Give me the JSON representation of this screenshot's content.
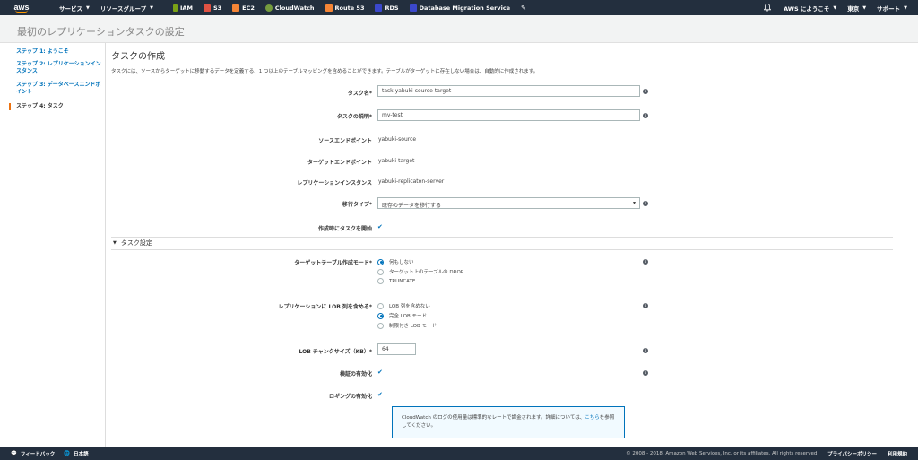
{
  "topnav": {
    "logo": "aws",
    "services": "サービス",
    "resource_groups": "リソースグループ",
    "shortcuts": [
      {
        "label": "IAM",
        "color": "#7aa116"
      },
      {
        "label": "S3",
        "color": "#e05243"
      },
      {
        "label": "EC2",
        "color": "#f58536"
      },
      {
        "label": "CloudWatch",
        "color": "#759c3e"
      },
      {
        "label": "Route 53",
        "color": "#f58536"
      },
      {
        "label": "RDS",
        "color": "#3b48cc"
      },
      {
        "label": "Database Migration Service",
        "color": "#3b48cc"
      }
    ],
    "pin_icon": "pin-icon",
    "bell_icon": "bell-icon",
    "account": "AWS にようこそ",
    "region": "東京",
    "support": "サポート"
  },
  "page_title": "最初のレプリケーションタスクの設定",
  "sidebar": {
    "steps": [
      {
        "label": "ステップ 1: ようこそ"
      },
      {
        "label": "ステップ 2: レプリケーションインスタンス"
      },
      {
        "label": "ステップ 3: データベースエンドポイント"
      },
      {
        "label": "ステップ 4: タスク"
      }
    ]
  },
  "main": {
    "title": "タスクの作成",
    "description": "タスクには、ソースからターゲットに移動するデータを定義する、1 つ以上のテーブルマッピングを含めることができます。テーブルがターゲットに存在しない場合は、自動的に作成されます。",
    "task_name_label": "タスク名*",
    "task_name_value": "task-yabuki-source-target",
    "task_desc_label": "タスクの説明*",
    "task_desc_value": "mv-test",
    "source_label": "ソースエンドポイント",
    "source_value": "yabuki-source",
    "target_label": "ターゲットエンドポイント",
    "target_value": "yabuki-target",
    "instance_label": "レプリケーションインスタンス",
    "instance_value": "yabuki-replicaton-server",
    "migration_type_label": "移行タイプ*",
    "migration_type_value": "既存のデータを移行する",
    "start_on_create_label": "作成時にタスクを開始",
    "section_title": "タスク設定",
    "target_table_mode_label": "ターゲットテーブル作成モード*",
    "target_table_mode_options": [
      "何もしない",
      "ターゲット上のテーブルの DROP",
      "TRUNCATE"
    ],
    "lob_label": "レプリケーションに LOB 列を含める*",
    "lob_options": [
      "LOB 列を含めない",
      "完全 LOB モード",
      "制限付き LOB モード"
    ],
    "lob_chunk_label": "LOB チャンクサイズ（KB）*",
    "lob_chunk_value": "64",
    "validation_label": "検証の有効化",
    "logging_label": "ロギングの有効化",
    "notice_text": "CloudWatch のログの使用量は標準的なレートで課金されます。詳細については、",
    "notice_link": "こちら",
    "notice_tail": "を参照してください。"
  },
  "footer": {
    "feedback": "フィードバック",
    "language": "日本語",
    "copyright": "© 2008 - 2018, Amazon Web Services, Inc. or its affiliates. All rights reserved.",
    "privacy": "プライバシーポリシー",
    "terms": "利用規約"
  }
}
